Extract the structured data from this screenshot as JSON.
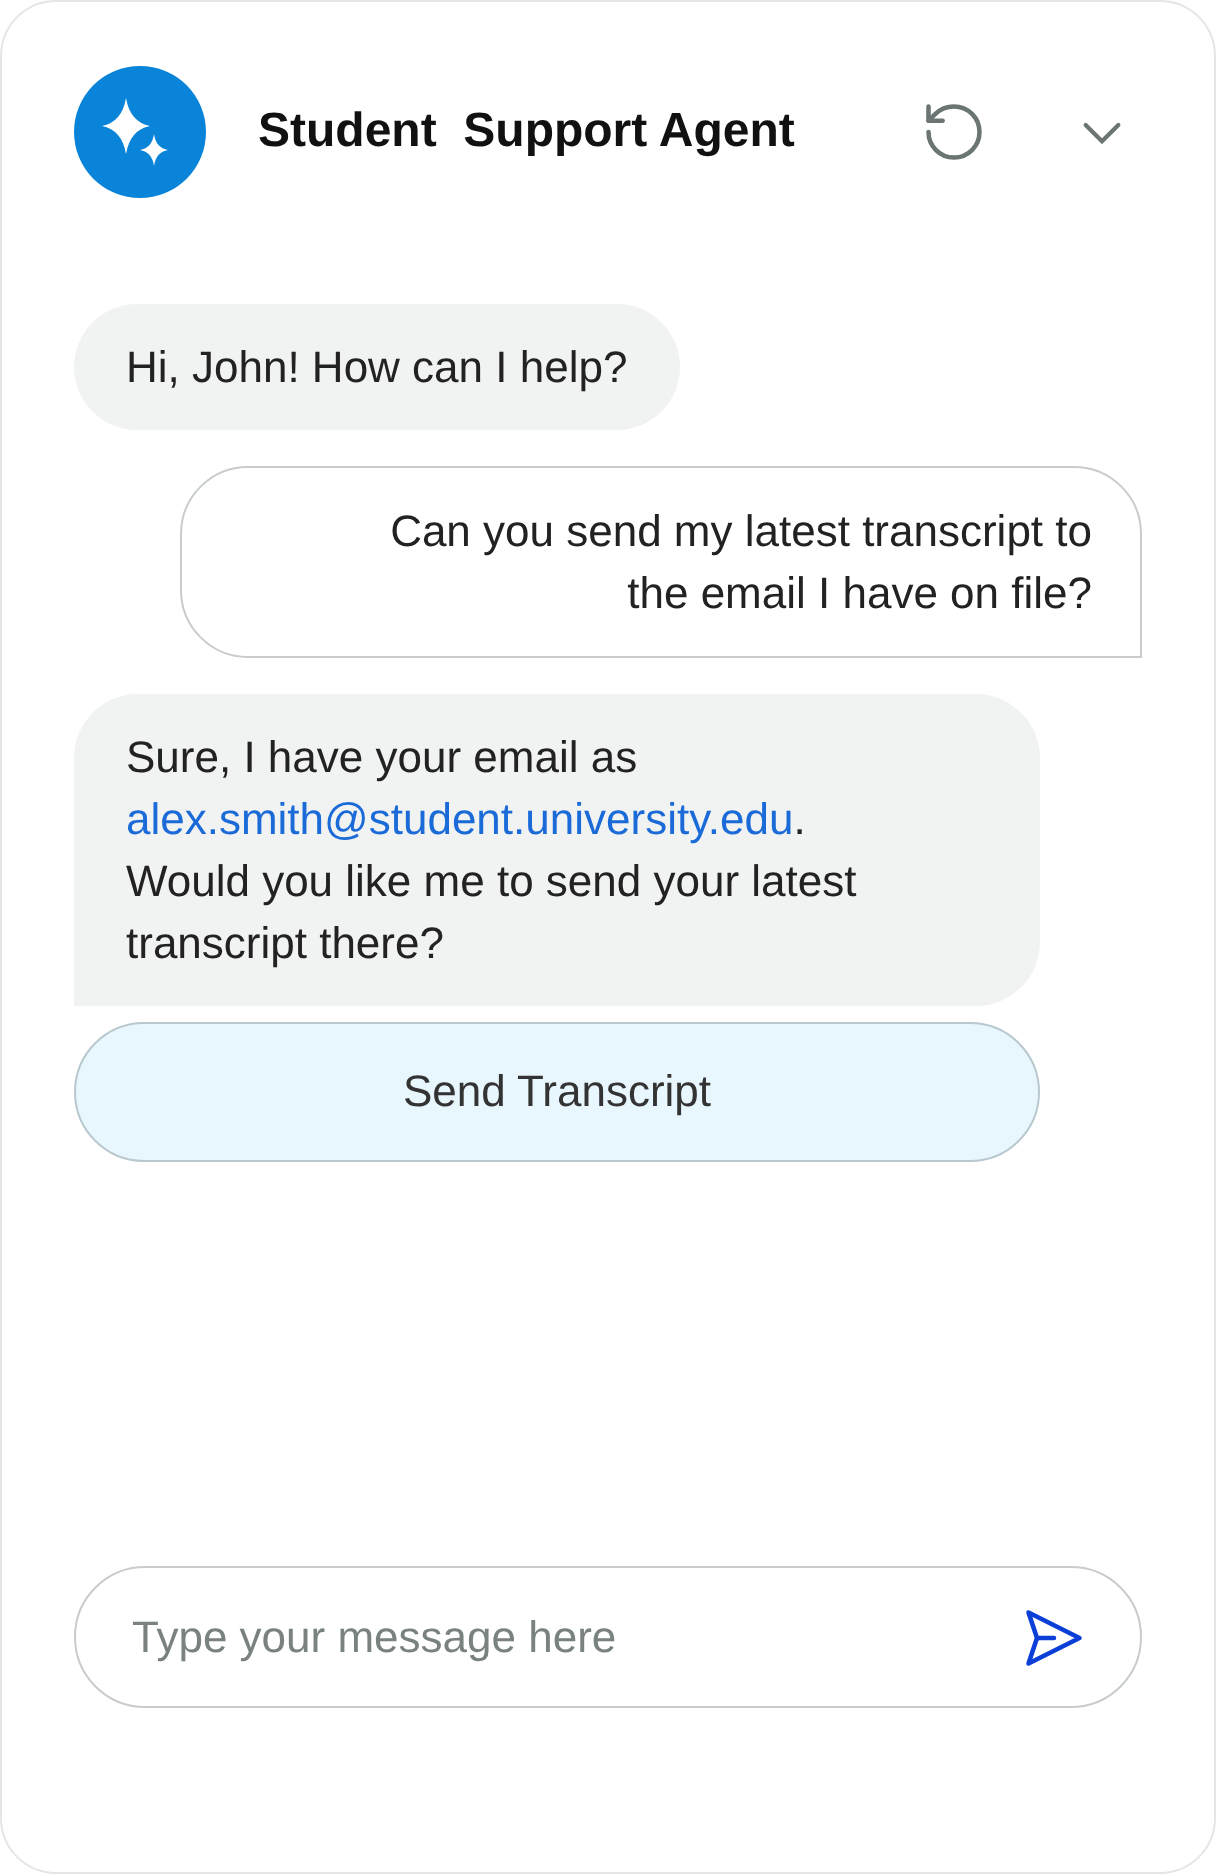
{
  "header": {
    "title": "Student  Support Agent"
  },
  "messages": [
    {
      "kind": "agent",
      "segments": [
        {
          "kind": "text",
          "text": "Hi, John! How can I help?"
        }
      ]
    },
    {
      "kind": "user",
      "segments": [
        {
          "kind": "text",
          "text": "Can you send my latest transcript to the email I have on file?"
        }
      ]
    },
    {
      "kind": "agent",
      "segments": [
        {
          "kind": "text",
          "text": "Sure, I have your email as "
        },
        {
          "kind": "link",
          "text": "alex.smith@student.university.edu"
        },
        {
          "kind": "text",
          "text": ". Would you like me to send your latest transcript there?"
        }
      ]
    }
  ],
  "action_button": {
    "label": "Send Transcript"
  },
  "composer": {
    "placeholder": "Type your message here"
  }
}
